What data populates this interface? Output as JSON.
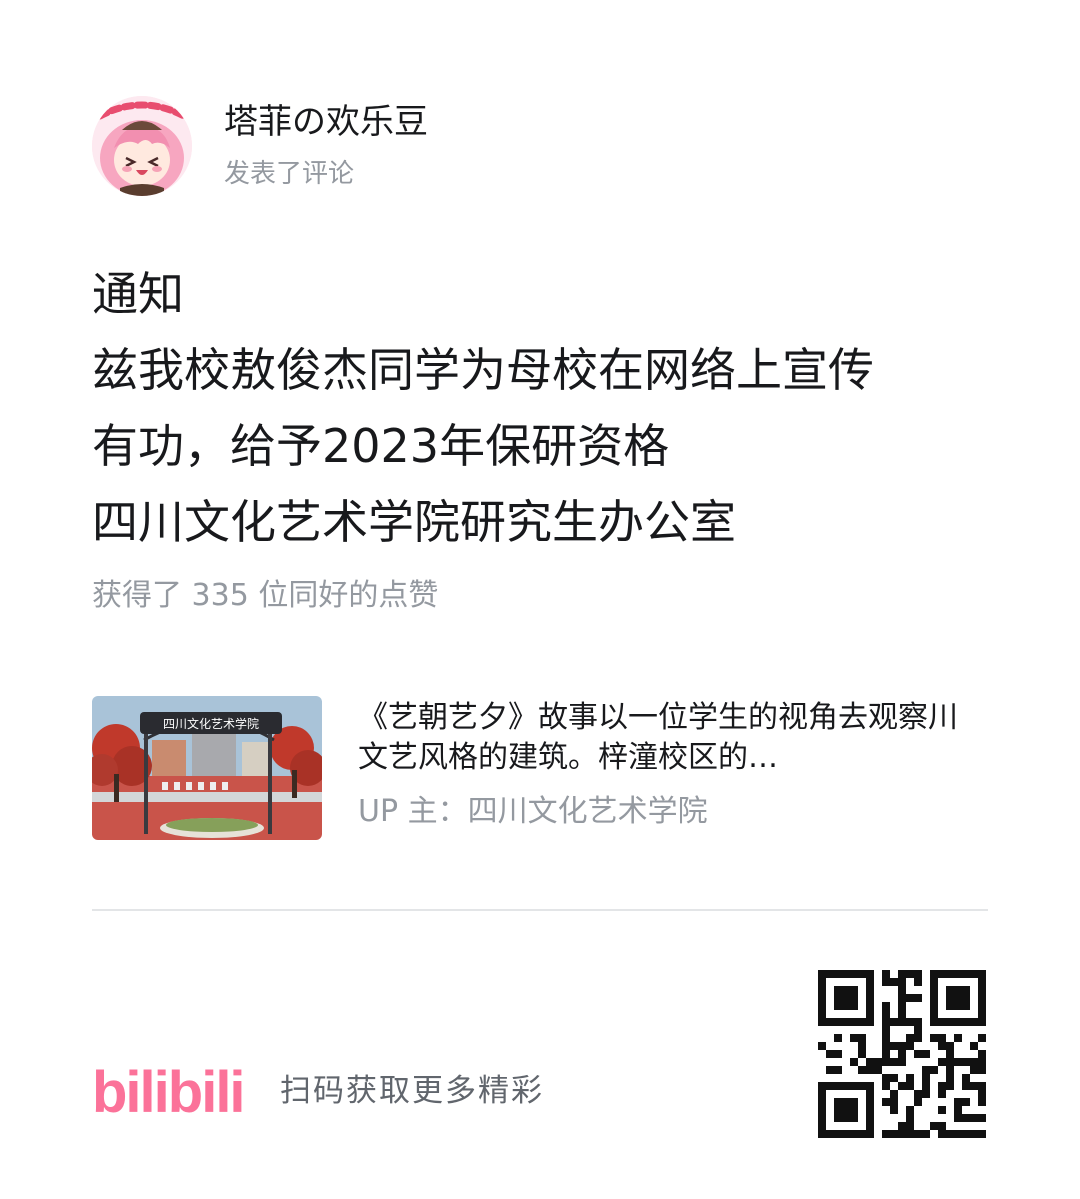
{
  "user": {
    "name": "塔菲の欢乐豆",
    "action": "发表了评论",
    "avatar_icon": "anime-girl-avatar"
  },
  "comment": {
    "lines": [
      "通知",
      "兹我校敖俊杰同学为母校在网络上宣传",
      "有功，给予2023年保研资格",
      "四川文化艺术学院研究生办公室"
    ]
  },
  "likes_text": "获得了 335 位同好的点赞",
  "video": {
    "thumbnail_icon": "campus-gate-thumbnail",
    "thumbnail_sign": "四川文化艺术学院",
    "description": "《艺朝艺夕》故事以一位学生的视角去观察川文艺风格的建筑。梓潼校区的…",
    "uploader": "UP 主：四川文化艺术学院"
  },
  "footer": {
    "logo_text": "bilibili",
    "cta": "扫码获取更多精彩",
    "qr_icon": "qr-code-icon"
  },
  "colors": {
    "brand_pink": "#fb7299",
    "text_primary": "#18191c",
    "text_secondary": "#9499a0"
  }
}
